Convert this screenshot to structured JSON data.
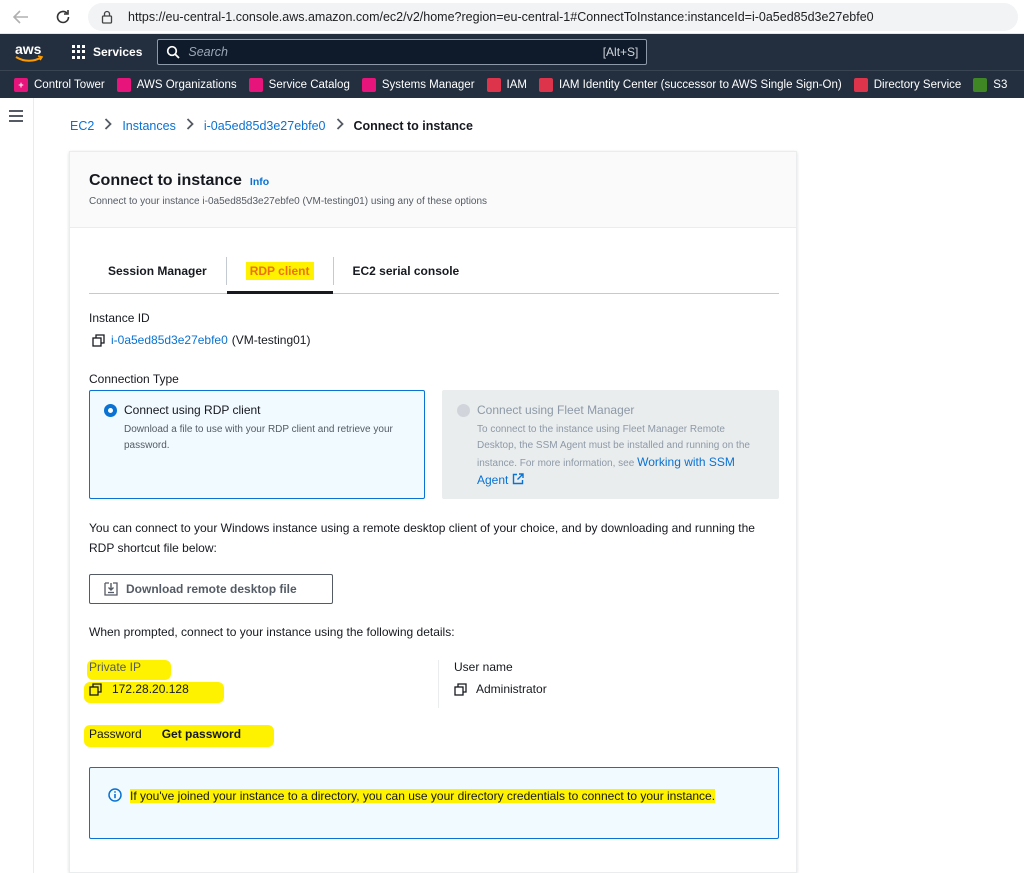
{
  "browser": {
    "url": "https://eu-central-1.console.aws.amazon.com/ec2/v2/home?region=eu-central-1#ConnectToInstance:instanceId=i-0a5ed85d3e27ebfe0"
  },
  "topnav": {
    "logo_text": "aws",
    "services_label": "Services",
    "search_placeholder": "Search",
    "search_shortcut": "[Alt+S]"
  },
  "favorites": [
    {
      "label": "Control Tower",
      "color": "#e7157b",
      "icon": "plus-icon"
    },
    {
      "label": "AWS Organizations",
      "color": "#e7157b",
      "icon": "organizations-icon"
    },
    {
      "label": "Service Catalog",
      "color": "#e7157b",
      "icon": "catalog-icon"
    },
    {
      "label": "Systems Manager",
      "color": "#e7157b",
      "icon": "systems-manager-icon"
    },
    {
      "label": "IAM",
      "color": "#dd344c",
      "icon": "iam-icon"
    },
    {
      "label": "IAM Identity Center (successor to AWS Single Sign-On)",
      "color": "#dd344c",
      "icon": "identity-center-icon"
    },
    {
      "label": "Directory Service",
      "color": "#dd344c",
      "icon": "directory-icon"
    },
    {
      "label": "S3",
      "color": "#3f8624",
      "icon": "s3-icon"
    }
  ],
  "breadcrumb": {
    "ec2": "EC2",
    "instances": "Instances",
    "instance_id": "i-0a5ed85d3e27ebfe0",
    "current": "Connect to instance"
  },
  "card": {
    "title": "Connect to instance",
    "info": "Info",
    "description": "Connect to your instance i-0a5ed85d3e27ebfe0 (VM-testing01) using any of these options"
  },
  "tabs": [
    {
      "label": "Session Manager",
      "active": false
    },
    {
      "label": "RDP client",
      "active": true
    },
    {
      "label": "EC2 serial console",
      "active": false
    }
  ],
  "instance": {
    "label": "Instance ID",
    "id": "i-0a5ed85d3e27ebfe0",
    "name": "(VM-testing01)"
  },
  "connection_type": {
    "label": "Connection Type",
    "rdp": {
      "title": "Connect using RDP client",
      "desc": "Download a file to use with your RDP client and retrieve your password."
    },
    "fleet": {
      "title": "Connect using Fleet Manager",
      "desc": "To connect to the instance using Fleet Manager Remote Desktop, the SSM Agent must be installed and running on the instance. For more information, see",
      "link": "Working with SSM Agent"
    }
  },
  "intro_text": "You can connect to your Windows instance using a remote desktop client of your choice, and by downloading and running the RDP shortcut file below:",
  "download_button": "Download remote desktop file",
  "prompt_text": "When prompted, connect to your instance using the following details:",
  "details": {
    "private_ip_label": "Private IP",
    "private_ip": "172.28.20.128",
    "username_label": "User name",
    "username": "Administrator",
    "password_label": "Password",
    "get_password": "Get password"
  },
  "alert_text": "If you've joined your instance to a directory, you can use your directory credentials to connect to your instance."
}
